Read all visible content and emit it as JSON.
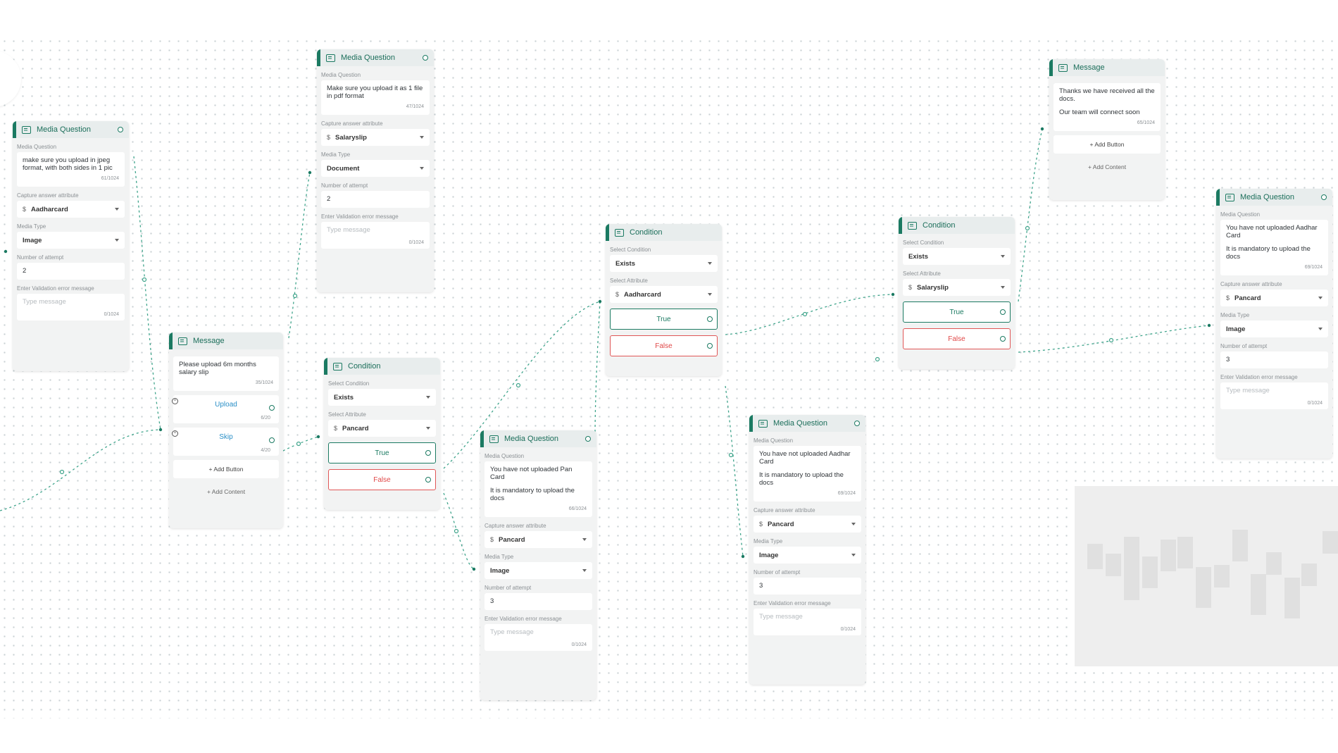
{
  "colors": {
    "accent": "#1b7a62",
    "false": "#e04848",
    "link": "#2a8fc7"
  },
  "icons": {
    "node": "chat-card-icon",
    "port": "output-port-icon",
    "remove": "remove-button-icon",
    "dropdown": "chevron-down-icon"
  },
  "nodes": {
    "mq1": {
      "title": "Media Question",
      "question_label": "Media Question",
      "question": "make sure you upload in jpeg format, with both sides in 1 pic",
      "question_count": "61/1024",
      "capture_label": "Capture answer attribute",
      "capture_value": "Aadharcard",
      "media_label": "Media Type",
      "media_value": "Image",
      "attempt_label": "Number of attempt",
      "attempt_value": "2",
      "error_label": "Enter Validation error message",
      "error_placeholder": "Type message",
      "error_count": "0/1024"
    },
    "msg1": {
      "title": "Message",
      "text": "Please upload 6m months salary slip",
      "text_count": "35/1024",
      "buttons": [
        {
          "label": "Upload",
          "count": "6/20"
        },
        {
          "label": "Skip",
          "count": "4/20"
        }
      ],
      "add_button": "+ Add Button",
      "add_content": "+ Add Content"
    },
    "mq2": {
      "title": "Media Question",
      "question_label": "Media Question",
      "question": "Make sure you upload it as 1 file in pdf format",
      "question_count": "47/1024",
      "capture_label": "Capture answer attribute",
      "capture_value": "Salaryslip",
      "media_label": "Media Type",
      "media_value": "Document",
      "attempt_label": "Number of attempt",
      "attempt_value": "2",
      "error_label": "Enter Validation error message",
      "error_placeholder": "Type message",
      "error_count": "0/1024"
    },
    "cond1": {
      "title": "Condition",
      "cond_label": "Select Condition",
      "cond_value": "Exists",
      "attr_label": "Select Attribute",
      "attr_value": "Pancard",
      "true_label": "True",
      "false_label": "False"
    },
    "mq3": {
      "title": "Media Question",
      "question_label": "Media Question",
      "question_line1": "You have not uploaded Pan Card",
      "question_line2": "It is mandatory to upload the docs",
      "question_count": "66/1024",
      "capture_label": "Capture answer attribute",
      "capture_value": "Pancard",
      "media_label": "Media Type",
      "media_value": "Image",
      "attempt_label": "Number of attempt",
      "attempt_value": "3",
      "error_label": "Enter Validation error message",
      "error_placeholder": "Type message",
      "error_count": "0/1024"
    },
    "cond2": {
      "title": "Condition",
      "cond_label": "Select Condition",
      "cond_value": "Exists",
      "attr_label": "Select Attribute",
      "attr_value": "Aadharcard",
      "true_label": "True",
      "false_label": "False"
    },
    "mq4": {
      "title": "Media Question",
      "question_label": "Media Question",
      "question_line1": "You have not uploaded Aadhar Card",
      "question_line2": "It is mandatory to upload the docs",
      "question_count": "69/1024",
      "capture_label": "Capture answer attribute",
      "capture_value": "Pancard",
      "media_label": "Media Type",
      "media_value": "Image",
      "attempt_label": "Number of attempt",
      "attempt_value": "3",
      "error_label": "Enter Validation error message",
      "error_placeholder": "Type message",
      "error_count": "0/1024"
    },
    "cond3": {
      "title": "Condition",
      "cond_label": "Select Condition",
      "cond_value": "Exists",
      "attr_label": "Select Attribute",
      "attr_value": "Salaryslip",
      "true_label": "True",
      "false_label": "False"
    },
    "msg2": {
      "title": "Message",
      "text_line1": "Thanks we have received all the docs.",
      "text_line2": "Our team will connect soon",
      "text_count": "65/1024",
      "add_button": "+ Add Button",
      "add_content": "+ Add Content"
    },
    "mq5": {
      "title": "Media Question",
      "question_label": "Media Question",
      "question_line1": "You have not uploaded Aadhar Card",
      "question_line2": "It is mandatory to upload the docs",
      "question_count": "69/1024",
      "capture_label": "Capture answer attribute",
      "capture_value": "Pancard",
      "media_label": "Media Type",
      "media_value": "Image",
      "attempt_label": "Number of attempt",
      "attempt_value": "3",
      "error_label": "Enter Validation error message",
      "error_placeholder": "Type message",
      "error_count": "0/1024"
    }
  }
}
